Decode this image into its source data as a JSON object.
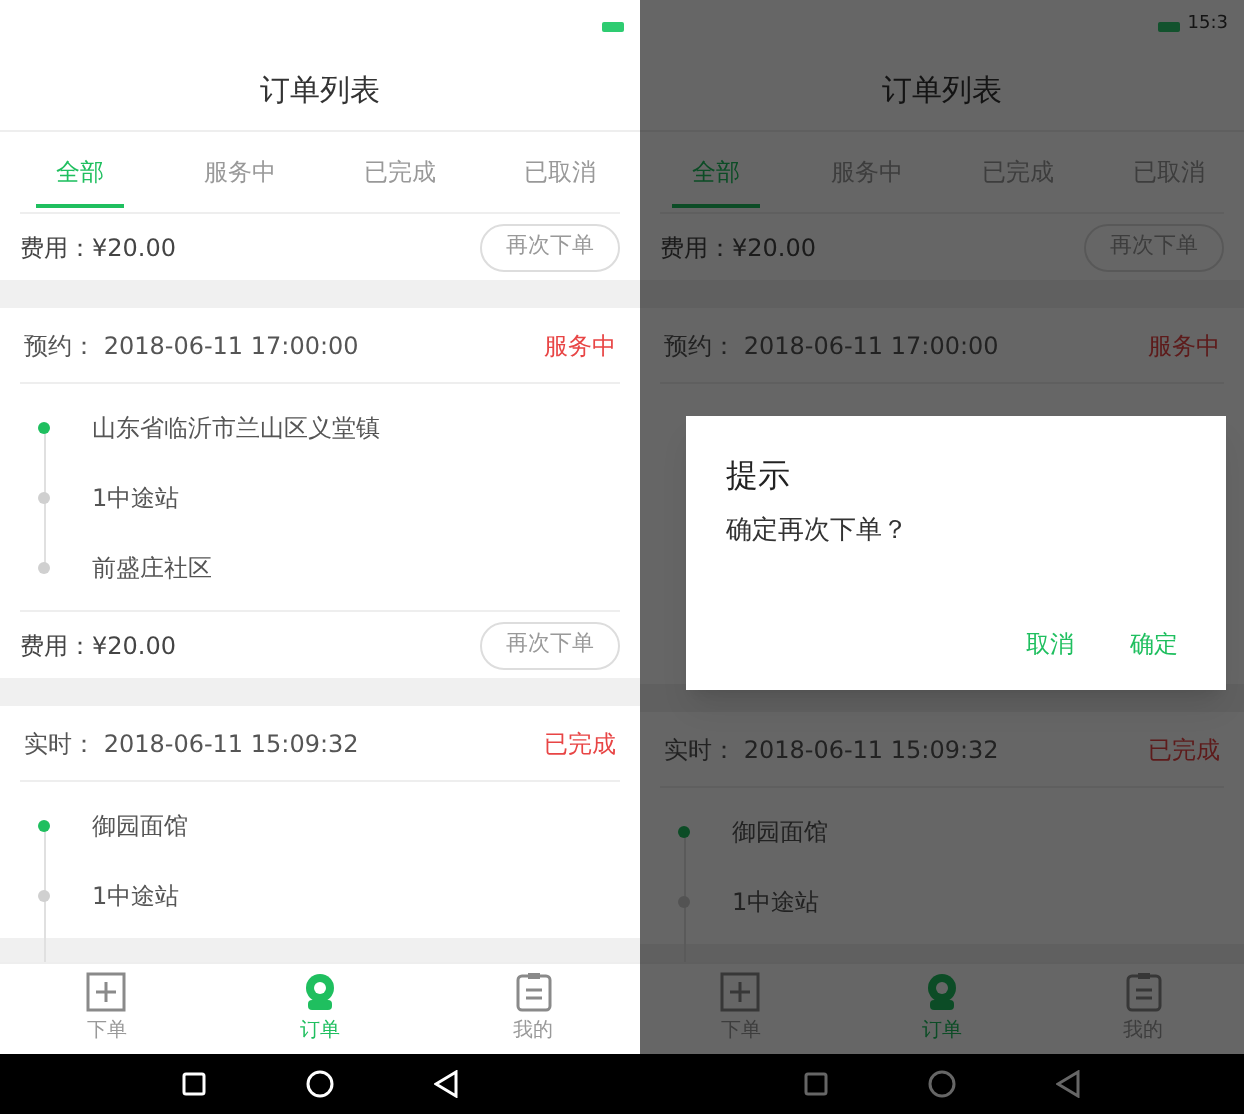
{
  "screens": [
    {
      "title": "订单列表",
      "tabs": [
        {
          "label": "全部",
          "selected": true
        },
        {
          "label": "服务中",
          "selected": false
        },
        {
          "label": "已完成",
          "selected": false
        },
        {
          "label": "已取消",
          "selected": false
        }
      ],
      "orders": [
        {
          "fee": "费用：¥20.00",
          "button": "再次下单"
        },
        {
          "type": "预约：",
          "time": "2018-06-11 17:00:00",
          "status": "服务中",
          "stops": [
            {
              "kind": "start",
              "name": "山东省临沂市兰山区义堂镇"
            },
            {
              "kind": "via",
              "name": "1中途站"
            },
            {
              "kind": "end",
              "name": "前盛庄社区"
            }
          ],
          "fee": "费用：¥20.00",
          "button": "再次下单"
        },
        {
          "type": "实时：",
          "time": "2018-06-11 15:09:32",
          "status": "已完成",
          "stops": [
            {
              "kind": "start",
              "name": "御园面馆"
            },
            {
              "kind": "via",
              "name": "1中途站"
            }
          ]
        }
      ],
      "nav": [
        {
          "kind": "plus",
          "label": "下单",
          "selected": false
        },
        {
          "kind": "person",
          "label": "订单",
          "selected": true
        },
        {
          "kind": "clipboard",
          "label": "我的",
          "selected": false
        }
      ]
    },
    {
      "status_bar": {
        "time": "15:3"
      },
      "title": "订单列表",
      "tabs": [
        {
          "label": "全部",
          "selected": true
        },
        {
          "label": "服务中",
          "selected": false
        },
        {
          "label": "已完成",
          "selected": false
        },
        {
          "label": "已取消",
          "selected": false
        }
      ],
      "orders": [
        {
          "fee": "费用：¥20.00",
          "button": "再次下单"
        },
        {
          "type": "预约：",
          "time": "2018-06-11 17:00:00",
          "status": "服务中"
        },
        {
          "type": "实时：",
          "time": "2018-06-11 15:09:32",
          "status": "已完成",
          "stops": [
            {
              "kind": "start",
              "name": "御园面馆"
            },
            {
              "kind": "via",
              "name": "1中途站"
            }
          ]
        }
      ],
      "nav": [
        {
          "kind": "plus",
          "label": "下单",
          "selected": false
        },
        {
          "kind": "person",
          "label": "订单",
          "selected": true
        },
        {
          "kind": "clipboard",
          "label": "我的",
          "selected": false
        }
      ],
      "dialog": {
        "title": "提示",
        "message": "确定再次下单？",
        "buttons": [
          "取消",
          "确定"
        ]
      }
    }
  ]
}
